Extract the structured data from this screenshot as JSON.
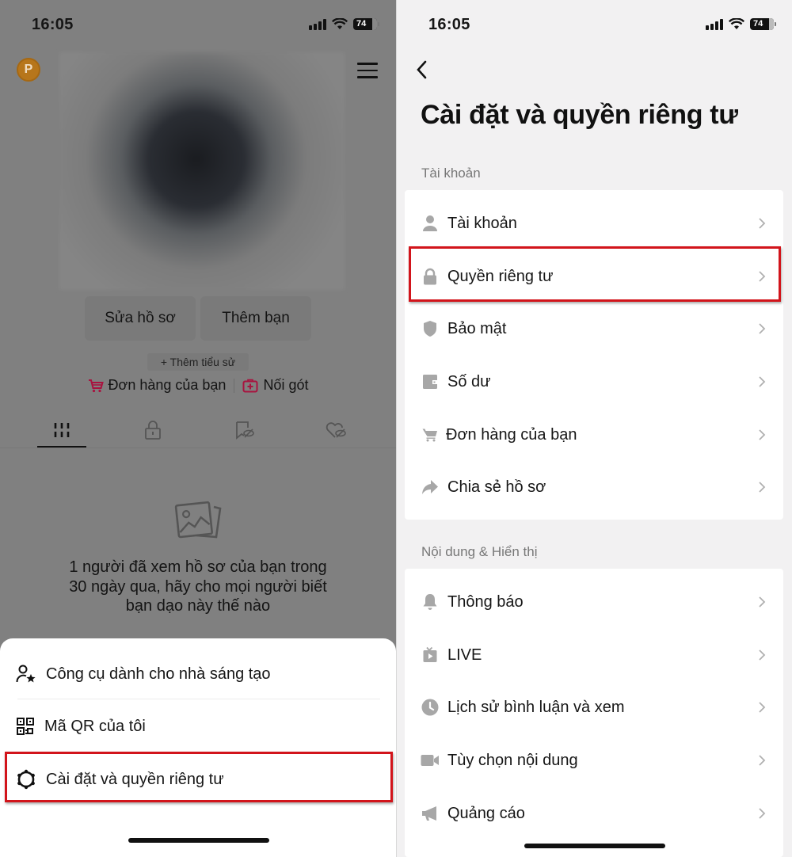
{
  "status_bar": {
    "time": "16:05",
    "battery": "74"
  },
  "profile": {
    "coin_letter": "P",
    "edit_profile_label": "Sửa hồ sơ",
    "add_friend_label": "Thêm bạn",
    "add_bio_label": "+ Thêm tiểu sử",
    "orders_label": "Đơn hàng của bạn",
    "favorites_label": "Nối gót",
    "tabs": [
      {
        "icon": "grid-icon",
        "active": true
      },
      {
        "icon": "lock-icon",
        "active": false
      },
      {
        "icon": "bookmark-hidden-icon",
        "active": false
      },
      {
        "icon": "heart-hidden-icon",
        "active": false
      }
    ],
    "empty_message": "1 người đã xem hồ sơ của bạn trong 30 ngày qua, hãy cho mọi người biết bạn dạo này thế nào"
  },
  "bottom_sheet": {
    "items": [
      {
        "label": "Công cụ dành cho nhà sáng tạo",
        "icon": "creator-tools-icon"
      },
      {
        "label": "Mã QR của tôi",
        "icon": "qr-code-icon"
      },
      {
        "label": "Cài đặt và quyền riêng tư",
        "icon": "settings-gear-icon",
        "highlighted": true
      }
    ]
  },
  "settings": {
    "title": "Cài đặt và quyền riêng tư",
    "sections": [
      {
        "label": "Tài khoản",
        "items": [
          {
            "label": "Tài khoản",
            "icon": "person-icon"
          },
          {
            "label": "Quyền riêng tư",
            "icon": "lock-icon",
            "highlighted": true
          },
          {
            "label": "Bảo mật",
            "icon": "shield-icon"
          },
          {
            "label": "Số dư",
            "icon": "wallet-icon"
          },
          {
            "label": "Đơn hàng của bạn",
            "icon": "cart-icon"
          },
          {
            "label": "Chia sẻ hồ sơ",
            "icon": "share-icon"
          }
        ]
      },
      {
        "label": "Nội dung & Hiển thị",
        "items": [
          {
            "label": "Thông báo",
            "icon": "bell-icon"
          },
          {
            "label": "LIVE",
            "icon": "live-tv-icon"
          },
          {
            "label": "Lịch sử bình luận và xem",
            "icon": "clock-icon"
          },
          {
            "label": "Tùy chọn nội dung",
            "icon": "video-camera-icon"
          },
          {
            "label": "Quảng cáo",
            "icon": "megaphone-icon"
          }
        ]
      }
    ]
  },
  "colors": {
    "highlight": "#d2141b",
    "accent_pink": "#c2154a",
    "overlay_gray": "#808080",
    "settings_bg": "#f2f1f2",
    "icon_gray": "#a7a7a7"
  }
}
